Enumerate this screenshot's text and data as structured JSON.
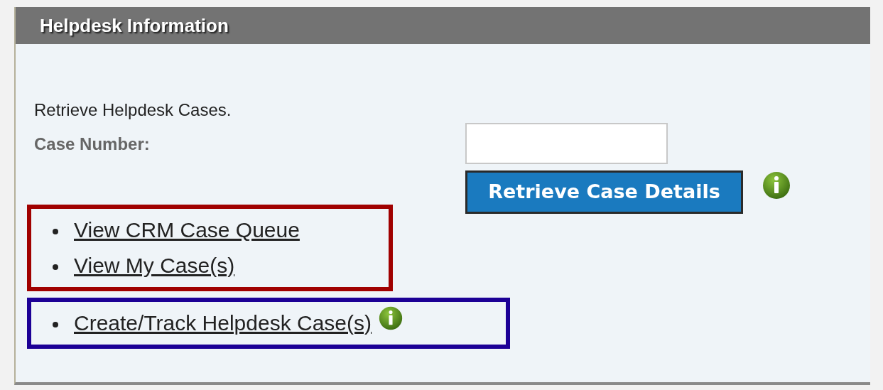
{
  "panel": {
    "title": "Helpdesk Information"
  },
  "intro": "Retrieve Helpdesk Cases.",
  "case_number": {
    "label": "Case Number:"
  },
  "retrieve_button": {
    "label": "Retrieve Case Details",
    "info": true
  },
  "link_groups": [
    {
      "color": "#a00000",
      "links": [
        {
          "label": "View CRM Case Queue",
          "info": false
        },
        {
          "label": "View My Case(s)",
          "info": false
        }
      ]
    },
    {
      "color": "#1c0096",
      "links": [
        {
          "label": "Create/Track Helpdesk Case(s)",
          "info": true
        }
      ]
    }
  ]
}
